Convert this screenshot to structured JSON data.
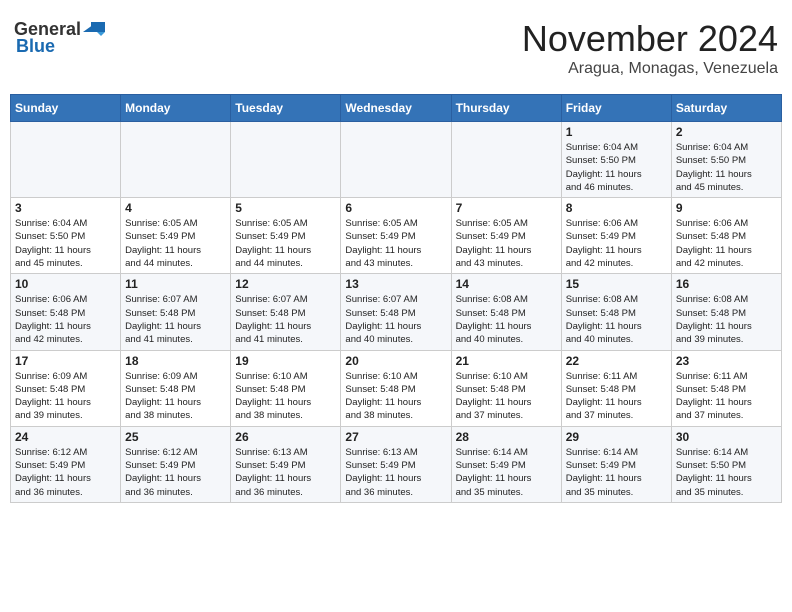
{
  "logo": {
    "general": "General",
    "blue": "Blue"
  },
  "header": {
    "month": "November 2024",
    "location": "Aragua, Monagas, Venezuela"
  },
  "weekdays": [
    "Sunday",
    "Monday",
    "Tuesday",
    "Wednesday",
    "Thursday",
    "Friday",
    "Saturday"
  ],
  "weeks": [
    [
      {
        "day": "",
        "info": ""
      },
      {
        "day": "",
        "info": ""
      },
      {
        "day": "",
        "info": ""
      },
      {
        "day": "",
        "info": ""
      },
      {
        "day": "",
        "info": ""
      },
      {
        "day": "1",
        "info": "Sunrise: 6:04 AM\nSunset: 5:50 PM\nDaylight: 11 hours\nand 46 minutes."
      },
      {
        "day": "2",
        "info": "Sunrise: 6:04 AM\nSunset: 5:50 PM\nDaylight: 11 hours\nand 45 minutes."
      }
    ],
    [
      {
        "day": "3",
        "info": "Sunrise: 6:04 AM\nSunset: 5:50 PM\nDaylight: 11 hours\nand 45 minutes."
      },
      {
        "day": "4",
        "info": "Sunrise: 6:05 AM\nSunset: 5:49 PM\nDaylight: 11 hours\nand 44 minutes."
      },
      {
        "day": "5",
        "info": "Sunrise: 6:05 AM\nSunset: 5:49 PM\nDaylight: 11 hours\nand 44 minutes."
      },
      {
        "day": "6",
        "info": "Sunrise: 6:05 AM\nSunset: 5:49 PM\nDaylight: 11 hours\nand 43 minutes."
      },
      {
        "day": "7",
        "info": "Sunrise: 6:05 AM\nSunset: 5:49 PM\nDaylight: 11 hours\nand 43 minutes."
      },
      {
        "day": "8",
        "info": "Sunrise: 6:06 AM\nSunset: 5:49 PM\nDaylight: 11 hours\nand 42 minutes."
      },
      {
        "day": "9",
        "info": "Sunrise: 6:06 AM\nSunset: 5:48 PM\nDaylight: 11 hours\nand 42 minutes."
      }
    ],
    [
      {
        "day": "10",
        "info": "Sunrise: 6:06 AM\nSunset: 5:48 PM\nDaylight: 11 hours\nand 42 minutes."
      },
      {
        "day": "11",
        "info": "Sunrise: 6:07 AM\nSunset: 5:48 PM\nDaylight: 11 hours\nand 41 minutes."
      },
      {
        "day": "12",
        "info": "Sunrise: 6:07 AM\nSunset: 5:48 PM\nDaylight: 11 hours\nand 41 minutes."
      },
      {
        "day": "13",
        "info": "Sunrise: 6:07 AM\nSunset: 5:48 PM\nDaylight: 11 hours\nand 40 minutes."
      },
      {
        "day": "14",
        "info": "Sunrise: 6:08 AM\nSunset: 5:48 PM\nDaylight: 11 hours\nand 40 minutes."
      },
      {
        "day": "15",
        "info": "Sunrise: 6:08 AM\nSunset: 5:48 PM\nDaylight: 11 hours\nand 40 minutes."
      },
      {
        "day": "16",
        "info": "Sunrise: 6:08 AM\nSunset: 5:48 PM\nDaylight: 11 hours\nand 39 minutes."
      }
    ],
    [
      {
        "day": "17",
        "info": "Sunrise: 6:09 AM\nSunset: 5:48 PM\nDaylight: 11 hours\nand 39 minutes."
      },
      {
        "day": "18",
        "info": "Sunrise: 6:09 AM\nSunset: 5:48 PM\nDaylight: 11 hours\nand 38 minutes."
      },
      {
        "day": "19",
        "info": "Sunrise: 6:10 AM\nSunset: 5:48 PM\nDaylight: 11 hours\nand 38 minutes."
      },
      {
        "day": "20",
        "info": "Sunrise: 6:10 AM\nSunset: 5:48 PM\nDaylight: 11 hours\nand 38 minutes."
      },
      {
        "day": "21",
        "info": "Sunrise: 6:10 AM\nSunset: 5:48 PM\nDaylight: 11 hours\nand 37 minutes."
      },
      {
        "day": "22",
        "info": "Sunrise: 6:11 AM\nSunset: 5:48 PM\nDaylight: 11 hours\nand 37 minutes."
      },
      {
        "day": "23",
        "info": "Sunrise: 6:11 AM\nSunset: 5:48 PM\nDaylight: 11 hours\nand 37 minutes."
      }
    ],
    [
      {
        "day": "24",
        "info": "Sunrise: 6:12 AM\nSunset: 5:49 PM\nDaylight: 11 hours\nand 36 minutes."
      },
      {
        "day": "25",
        "info": "Sunrise: 6:12 AM\nSunset: 5:49 PM\nDaylight: 11 hours\nand 36 minutes."
      },
      {
        "day": "26",
        "info": "Sunrise: 6:13 AM\nSunset: 5:49 PM\nDaylight: 11 hours\nand 36 minutes."
      },
      {
        "day": "27",
        "info": "Sunrise: 6:13 AM\nSunset: 5:49 PM\nDaylight: 11 hours\nand 36 minutes."
      },
      {
        "day": "28",
        "info": "Sunrise: 6:14 AM\nSunset: 5:49 PM\nDaylight: 11 hours\nand 35 minutes."
      },
      {
        "day": "29",
        "info": "Sunrise: 6:14 AM\nSunset: 5:49 PM\nDaylight: 11 hours\nand 35 minutes."
      },
      {
        "day": "30",
        "info": "Sunrise: 6:14 AM\nSunset: 5:50 PM\nDaylight: 11 hours\nand 35 minutes."
      }
    ]
  ]
}
